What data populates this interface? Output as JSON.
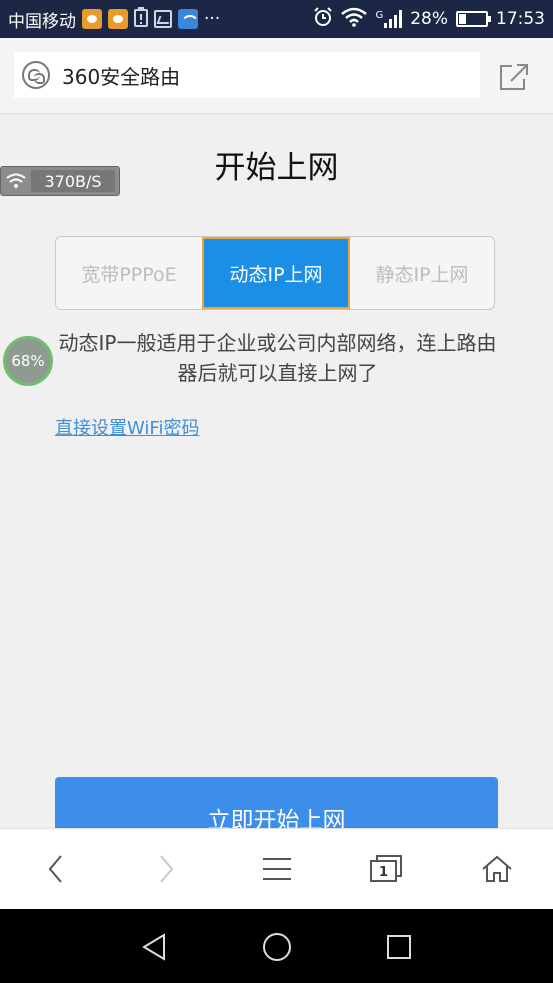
{
  "status_bar": {
    "carrier": "中国移动",
    "more": "···",
    "network_label": "G",
    "battery_percent": "28%",
    "battery_level": 0.28,
    "time": "17:53"
  },
  "address_bar": {
    "url_text": "360安全路由"
  },
  "speed_badge": {
    "value": "370B/S"
  },
  "progress": {
    "label": "68%"
  },
  "page": {
    "title": "开始上网",
    "tabs": [
      {
        "label": "宽带PPPoE",
        "active": false
      },
      {
        "label": "动态IP上网",
        "active": true
      },
      {
        "label": "静态IP上网",
        "active": false
      }
    ],
    "description": "动态IP一般适用于企业或公司内部网络，连上路由器后就可以直接上网了",
    "wifi_link": "直接设置WiFi密码",
    "start_button": "立即开始上网"
  },
  "toolbar": {
    "tab_count": "1"
  },
  "colors": {
    "status_bar": "#1c2746",
    "accent": "#1b8fe6",
    "button": "#3d8eea",
    "link": "#3d8fd8"
  }
}
